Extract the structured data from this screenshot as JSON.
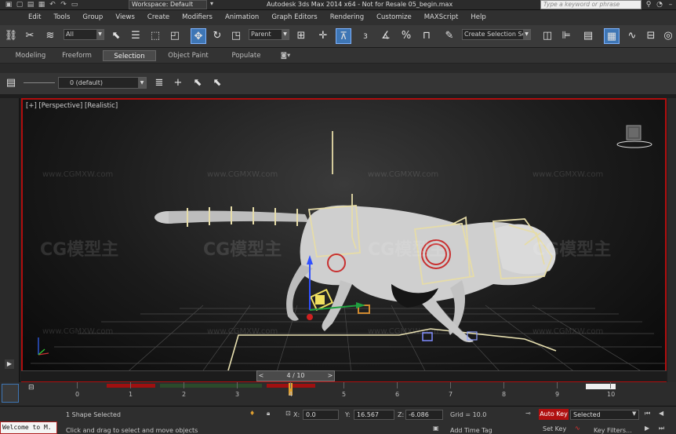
{
  "titlebar": {
    "workspace": "Workspace: Default",
    "title": "Autodesk 3ds Max  2014 x64  - Not for Resale   05_begin.max",
    "help_search_placeholder": "Type a keyword or phrase"
  },
  "menu": [
    "Edit",
    "Tools",
    "Group",
    "Views",
    "Create",
    "Modifiers",
    "Animation",
    "Graph Editors",
    "Rendering",
    "Customize",
    "MAXScript",
    "Help"
  ],
  "toolbar": {
    "selection_filter": "All",
    "reference_coord": "Parent",
    "snap_label": "3",
    "named_selection": "Create Selection Se"
  },
  "ribbon": {
    "tabs": [
      "Modeling",
      "Freeform",
      "Selection",
      "Object Paint",
      "Populate"
    ],
    "active_tab": "Selection"
  },
  "layer": {
    "current": "0 (default)"
  },
  "viewport": {
    "label": "[+] [Perspective] [Realistic]",
    "border_color": "#b00e0e",
    "watermark_logo": "CG模型主",
    "watermark_url": "www.CGMXW.com"
  },
  "time_slider": {
    "frame": "4 / 10"
  },
  "trackbar": {
    "ticks": [
      "0",
      "1",
      "2",
      "3",
      "4",
      "5",
      "6",
      "7",
      "8",
      "9",
      "10"
    ]
  },
  "status": {
    "selection": "1 Shape Selected",
    "prompt": "Click and drag to select and move objects",
    "x_label": "X:",
    "x_value": "0.0",
    "y_label": "Y:",
    "y_value": "16.567",
    "z_label": "Z:",
    "z_value": "-6.086",
    "grid": "Grid = 10.0",
    "add_time_tag": "Add Time Tag",
    "auto_key": "Auto Key",
    "selected": "Selected",
    "set_key": "Set Key",
    "key_filters": "Key Filters...",
    "listener": "Welcome to M."
  }
}
